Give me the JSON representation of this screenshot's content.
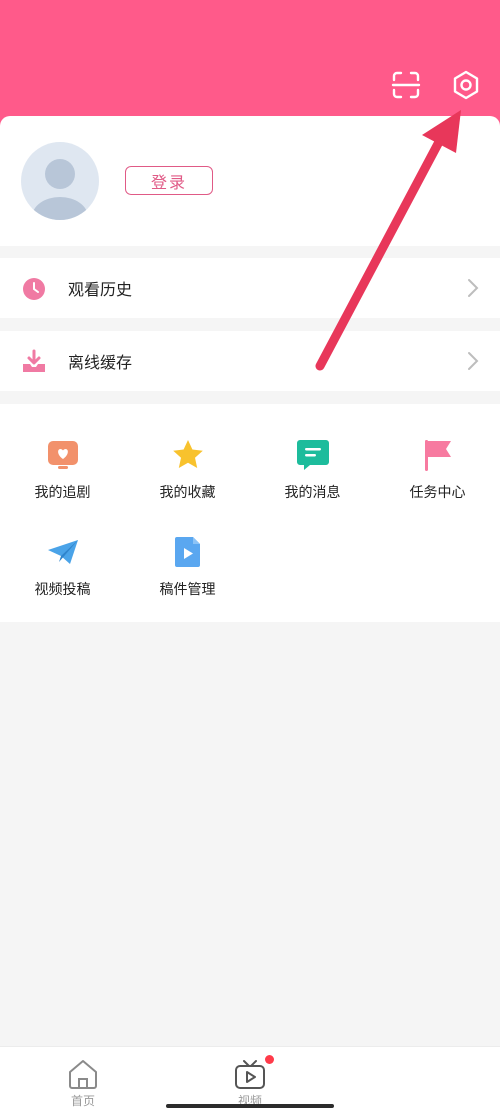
{
  "header": {
    "bg_color": "#ff5a8a",
    "icons": [
      "scan-icon",
      "settings-gear-icon"
    ]
  },
  "profile": {
    "login_label": "登录",
    "accent_color": "#e05a86"
  },
  "list": {
    "history_label": "观看历史",
    "offline_label": "离线缓存"
  },
  "grid": {
    "items": [
      {
        "label": "我的追剧",
        "icon": "tv-heart-icon",
        "color": "#f2916b"
      },
      {
        "label": "我的收藏",
        "icon": "star-icon",
        "color": "#f8c22d"
      },
      {
        "label": "我的消息",
        "icon": "message-icon",
        "color": "#1dbc9c"
      },
      {
        "label": "任务中心",
        "icon": "flag-icon",
        "color": "#f77aa0"
      },
      {
        "label": "视频投稿",
        "icon": "paper-plane-icon",
        "color": "#4aa3e8"
      },
      {
        "label": "稿件管理",
        "icon": "video-file-icon",
        "color": "#5aa7f0"
      }
    ]
  },
  "tabbar": {
    "home_label": "首页",
    "video_label": "视频"
  },
  "annotation": {
    "arrow_color": "#e8375a",
    "points_to": "settings-gear-icon"
  }
}
